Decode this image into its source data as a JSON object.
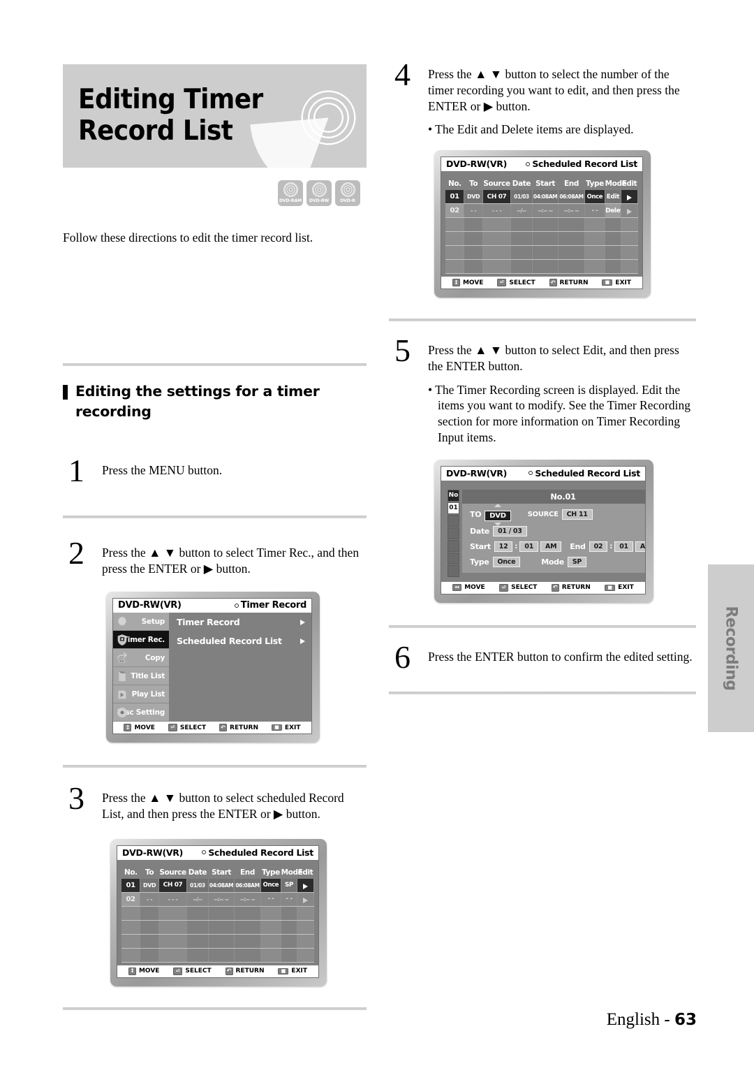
{
  "page": {
    "title": "Editing Timer Record List",
    "intro": "Follow these directions to edit the timer record list.",
    "side_tab": "Recording",
    "footer_label": "English - ",
    "footer_page": "63"
  },
  "disc_icons": [
    {
      "label": "DVD-RAM"
    },
    {
      "label": "DVD-RW"
    },
    {
      "label": "DVD-R"
    }
  ],
  "section": {
    "heading": "Editing the settings for a timer recording"
  },
  "steps": {
    "s1": {
      "num": "1",
      "text": "Press the MENU button."
    },
    "s2": {
      "num": "2",
      "text": "Press the ▲ ▼ button to select Timer Rec., and then press the ENTER or ▶ button."
    },
    "s3": {
      "num": "3",
      "text": "Press the ▲ ▼ button to select scheduled Record List, and then press the ENTER or ▶ button."
    },
    "s4": {
      "num": "4",
      "text": "Press the ▲ ▼ button to select the number of the timer recording you want to edit, and then press the ENTER or ▶ button.",
      "bullet1": "• The Edit and Delete items are displayed."
    },
    "s5": {
      "num": "5",
      "text": "Press the ▲ ▼ button to select Edit, and then press the ENTER button.",
      "bullet1": "• The Timer Recording screen is displayed. Edit the items you want to modify. See the Timer Recording section for more information on Timer Recording Input items."
    },
    "s6": {
      "num": "6",
      "text": "Press the ENTER button to confirm the edited setting."
    }
  },
  "nav_bar": {
    "move": "MOVE",
    "select": "SELECT",
    "return": "RETURN",
    "exit": "EXIT"
  },
  "menu_screen": {
    "disc_label": "DVD-RW(VR)",
    "screen_title": "Timer Record",
    "sidebar": [
      {
        "label": "Setup",
        "active": false
      },
      {
        "label": "Timer Rec.",
        "active": true
      },
      {
        "label": "Copy",
        "active": false
      },
      {
        "label": "Title List",
        "active": false
      },
      {
        "label": "Play List",
        "active": false
      },
      {
        "label": "Disc Setting",
        "active": false
      }
    ],
    "items": [
      {
        "label": "Timer Record"
      },
      {
        "label": "Scheduled Record List"
      }
    ]
  },
  "list_screen_step3": {
    "disc_label": "DVD-RW(VR)",
    "screen_title": "Scheduled Record List",
    "columns": [
      "No.",
      "To",
      "Source",
      "Date",
      "Start",
      "End",
      "Type",
      "Mode",
      "Edit"
    ],
    "row1": {
      "no": "01",
      "to": "DVD",
      "source": "CH  07",
      "date": "01/03",
      "start": "04:08AM",
      "end": "06:08AM",
      "type": "Once",
      "mode": "SP"
    },
    "row2": {
      "no": "02",
      "to": "- -",
      "source": "- - -",
      "date": "--/--",
      "start": "--:-- --",
      "end": "--:-- --",
      "type": "- -",
      "mode": "- -"
    }
  },
  "list_screen_step4": {
    "disc_label": "DVD-RW(VR)",
    "screen_title": "Scheduled Record List",
    "columns": [
      "No.",
      "To",
      "Source",
      "Date",
      "Start",
      "End",
      "Type",
      "Mode",
      "Edit"
    ],
    "row1": {
      "no": "01",
      "to": "DVD",
      "source": "CH  07",
      "date": "01/03",
      "start": "04:08AM",
      "end": "06:08AM",
      "type": "Once",
      "mode": "Edit"
    },
    "row2": {
      "no": "02",
      "to": "- -",
      "source": "- - -",
      "date": "--/--",
      "start": "--:-- --",
      "end": "--:-- --",
      "type": "- -",
      "mode": "Delete"
    }
  },
  "form_screen_step5": {
    "disc_label": "DVD-RW(VR)",
    "screen_title": "Scheduled Record List",
    "col_header": "No",
    "selected_row": "01",
    "form_title": "No.01",
    "to_label": "TO",
    "to_value": "DVD",
    "source_label": "SOURCE",
    "source_value": "CH  11",
    "date_label": "Date",
    "date_month": "01",
    "date_sep": "/",
    "date_day": "03",
    "start_label": "Start",
    "start_hour": "12",
    "start_min": "01",
    "start_ampm": "AM",
    "end_label": "End",
    "end_hour": "02",
    "end_min": "01",
    "end_ampm": "AM",
    "type_label": "Type",
    "type_value": "Once",
    "mode_label": "Mode",
    "mode_value": "SP",
    "time_sep": ":"
  }
}
